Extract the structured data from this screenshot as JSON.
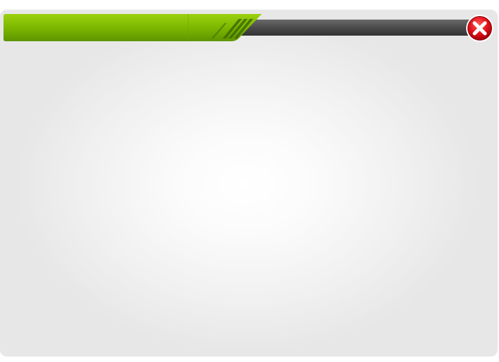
{
  "window": {
    "title": ""
  },
  "titlebar": {
    "accent_color": "#86bc00",
    "bar_color": "#4a4a4a"
  },
  "close_button": {
    "icon": "close-icon",
    "color": "#e0141c"
  }
}
